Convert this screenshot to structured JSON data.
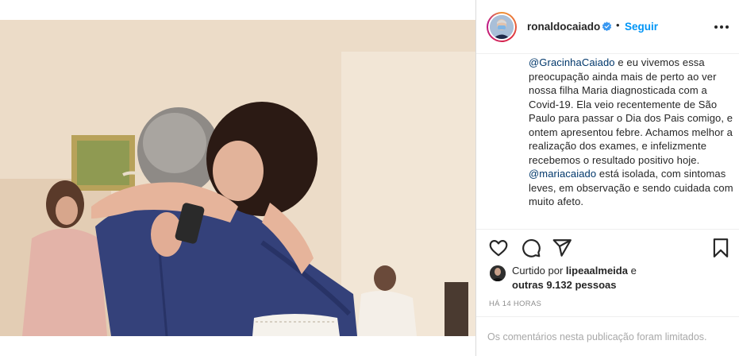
{
  "post": {
    "username": "ronaldocaiado",
    "separator": "•",
    "follow_label": "Seguir",
    "caption": {
      "mention1": "@GracinhaCaiado",
      "part1": " e eu vivemos essa preocupação ainda mais de perto ao ver nossa filha Maria diagnosticada com a Covid-19. Ela veio recentemente de São Paulo para passar o Dia dos Pais comigo, e ontem apresentou febre. Achamos melhor a realização dos exames, e infelizmente recebemos o resultado positivo hoje. ",
      "mention2": "@mariacaiado",
      "part2": " está isolada, com sintomas leves, em observação e sendo cuidada com muito afeto."
    },
    "likes": {
      "prefix": "Curtido por ",
      "user": "lipeaalmeida",
      "joiner": " e",
      "others": "outras 9.132 pessoas"
    },
    "timestamp": "HÁ 14 HORAS",
    "comments_limited": "Os comentários nesta publicação foram limitados."
  },
  "icons": [
    "verified-badge-icon",
    "more-options-icon",
    "heart-icon",
    "comment-icon",
    "share-icon",
    "bookmark-icon"
  ],
  "colors": {
    "link": "#0095f6",
    "mention": "#00376b",
    "text": "#262626",
    "muted": "#8e8e8e",
    "verified": "#3897f0"
  }
}
